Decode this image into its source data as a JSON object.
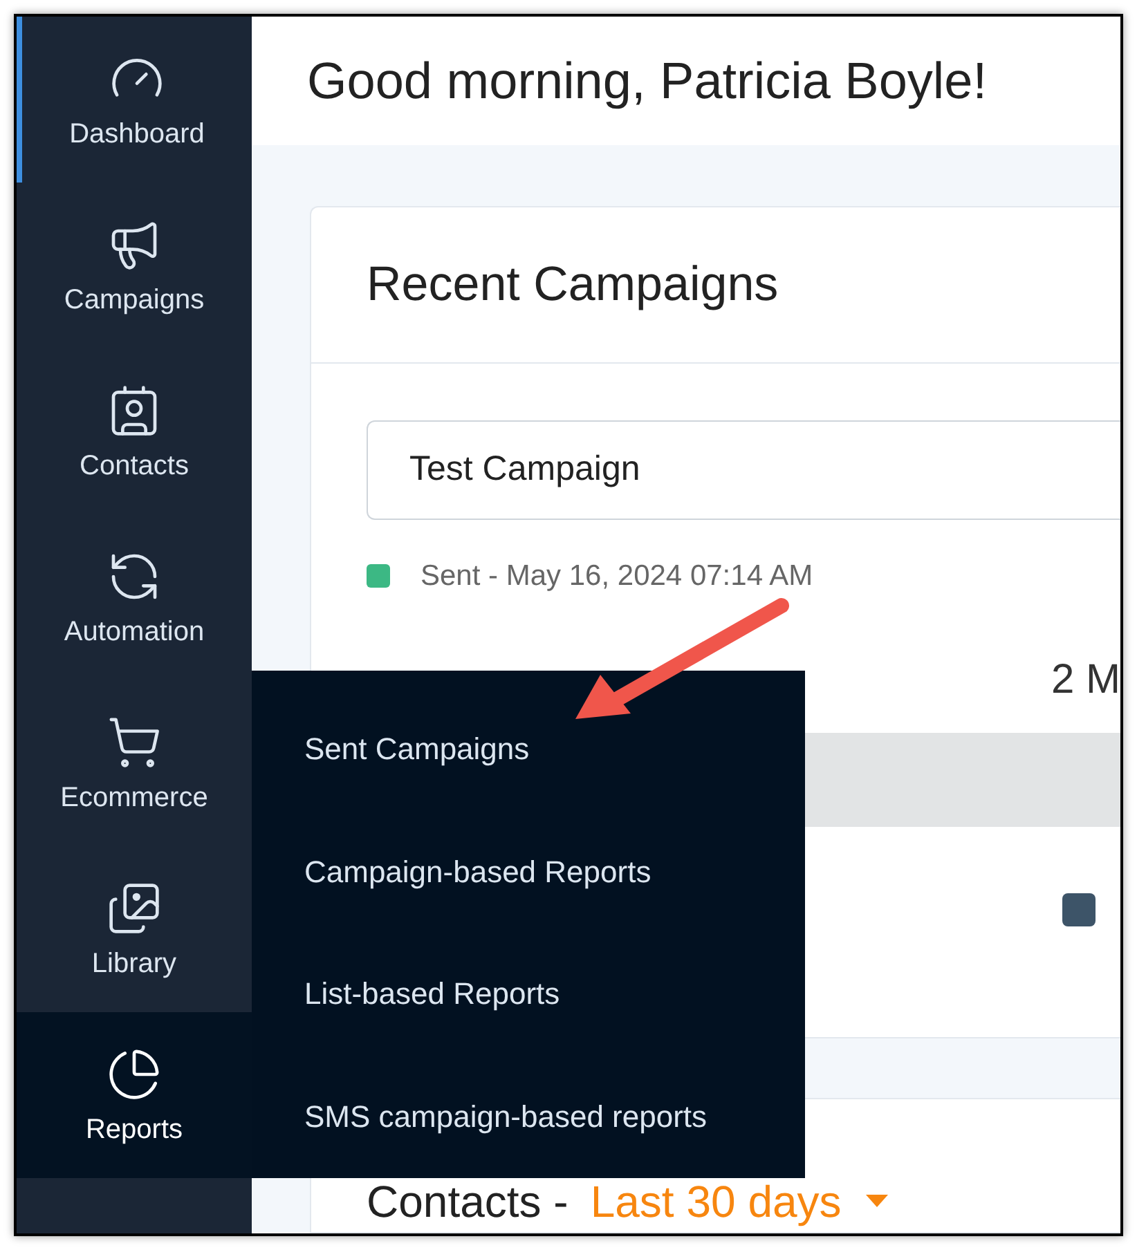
{
  "greeting": "Good morning, Patricia Boyle!",
  "sidebar": {
    "items": [
      {
        "label": "Dashboard",
        "selected": true,
        "open": false
      },
      {
        "label": "Campaigns",
        "selected": false,
        "open": false
      },
      {
        "label": "Contacts",
        "selected": false,
        "open": false
      },
      {
        "label": "Automation",
        "selected": false,
        "open": false
      },
      {
        "label": "Ecommerce",
        "selected": false,
        "open": false
      },
      {
        "label": "Library",
        "selected": false,
        "open": false
      },
      {
        "label": "Reports",
        "selected": false,
        "open": true
      }
    ]
  },
  "reports_menu": {
    "items": [
      "Sent Campaigns",
      "Campaign-based Reports",
      "List-based Reports",
      "SMS campaign-based reports"
    ]
  },
  "recent_campaigns": {
    "title": "Recent Campaigns",
    "campaign_select": {
      "value": "Test Campaign"
    },
    "status": {
      "text": "Sent - May 16, 2024 07:14 AM",
      "color": "#3cb884"
    },
    "column_2": "2 M"
  },
  "contacts": {
    "title": "Contacts -",
    "range": "Last 30 days"
  }
}
